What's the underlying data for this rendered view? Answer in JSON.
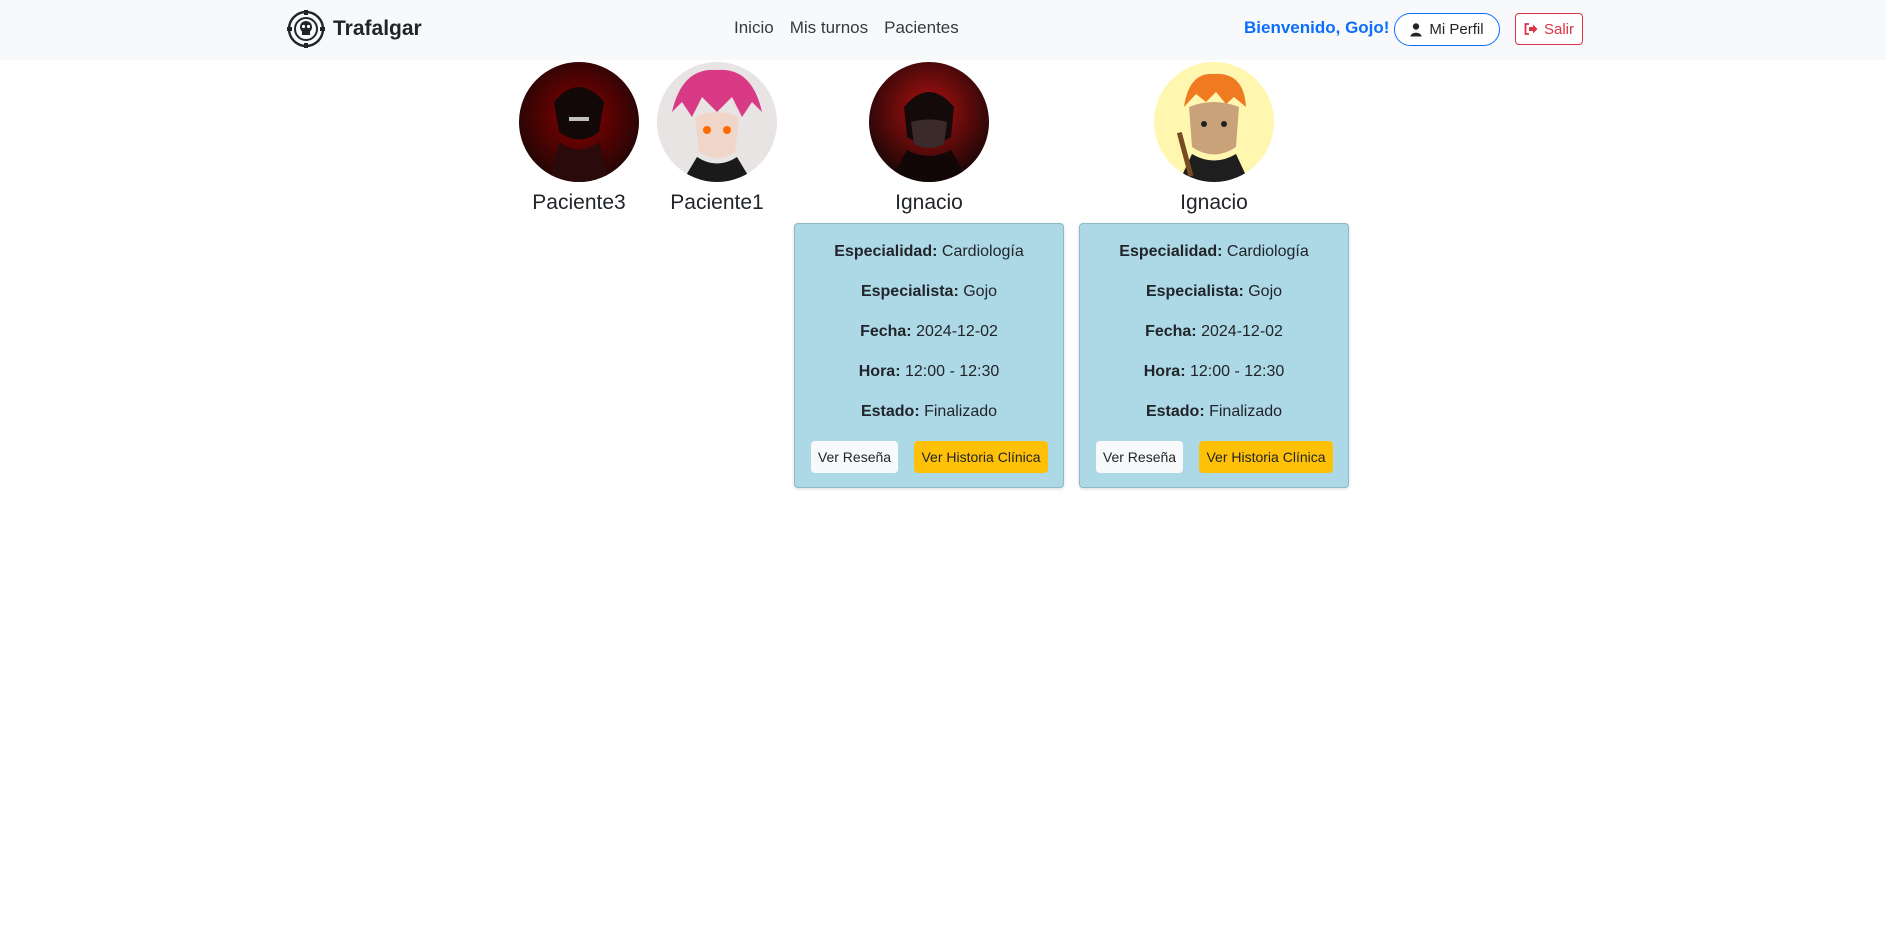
{
  "brand": {
    "name": "Trafalgar",
    "icon": "jolly-roger-icon"
  },
  "nav": {
    "items": [
      "Inicio",
      "Mis turnos",
      "Pacientes"
    ]
  },
  "user": {
    "welcome": "Bienvenido, Gojo!",
    "profile_label": "Mi Perfil",
    "logout_label": "Salir"
  },
  "patients": [
    {
      "name": "Paciente3",
      "avatar_colors": [
        "#1a0505",
        "#8b0000"
      ]
    },
    {
      "name": "Paciente1",
      "avatar_colors": [
        "#2a1a2a",
        "#e0408a"
      ]
    },
    {
      "name": "Ignacio",
      "avatar_colors": [
        "#0d0505",
        "#b01010"
      ]
    },
    {
      "name": "Ignacio",
      "avatar_colors": [
        "#fff7b0",
        "#f07a20"
      ]
    }
  ],
  "cards": [
    {
      "especialidad_label": "Especialidad:",
      "especialidad": "Cardiología",
      "especialista_label": "Especialista:",
      "especialista": "Gojo",
      "fecha_label": "Fecha:",
      "fecha": "2024-12-02",
      "hora_label": "Hora:",
      "hora": "12:00 - 12:30",
      "estado_label": "Estado:",
      "estado": "Finalizado",
      "resena_label": "Ver Reseña",
      "historia_label": "Ver Historia Clínica"
    },
    {
      "especialidad_label": "Especialidad:",
      "especialidad": "Cardiología",
      "especialista_label": "Especialista:",
      "especialista": "Gojo",
      "fecha_label": "Fecha:",
      "fecha": "2024-12-02",
      "hora_label": "Hora:",
      "hora": "12:00 - 12:30",
      "estado_label": "Estado:",
      "estado": "Finalizado",
      "resena_label": "Ver Reseña",
      "historia_label": "Ver Historia Clínica"
    }
  ],
  "colors": {
    "accent": "#0d6efd",
    "danger": "#dc3545",
    "card_bg": "#add8e6",
    "warning": "#ffc107"
  }
}
